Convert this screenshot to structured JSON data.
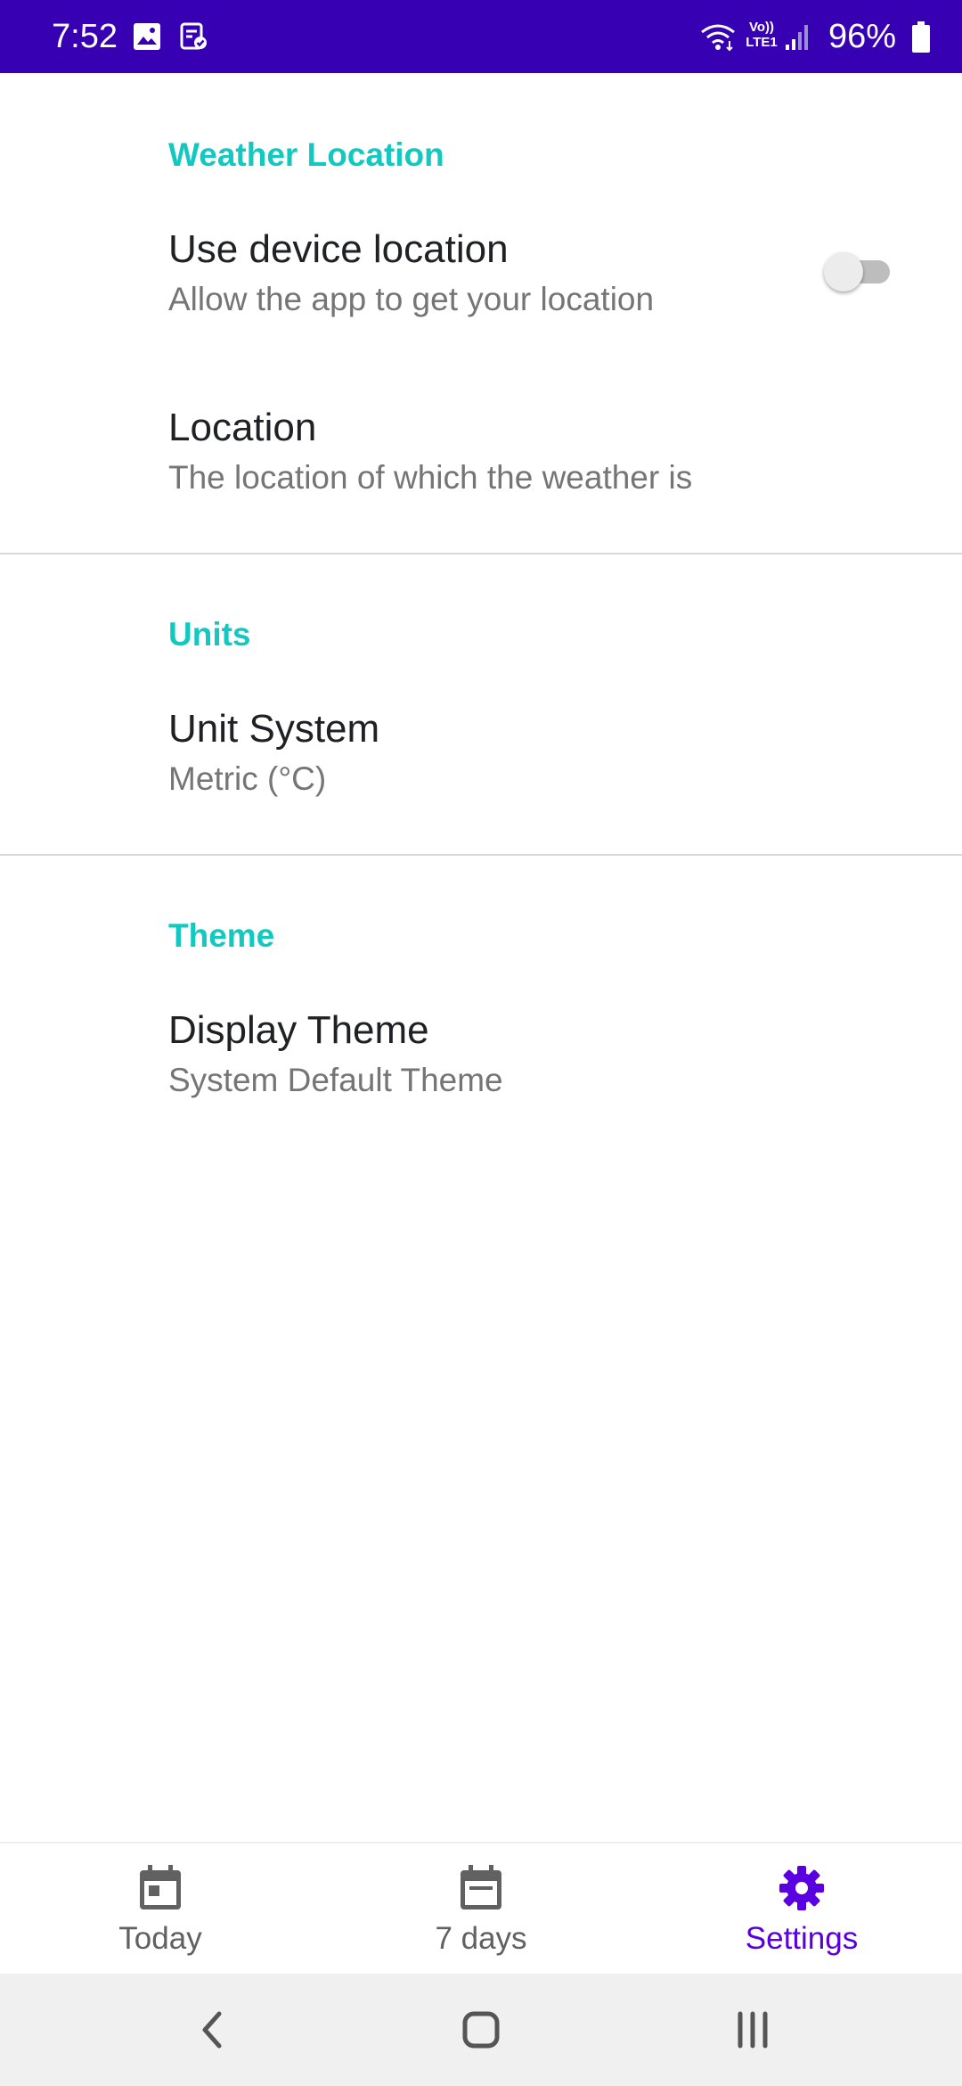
{
  "status_bar": {
    "time": "7:52",
    "battery": "96%",
    "background": "#3700b3",
    "left_icons": [
      "gallery-icon",
      "task-done-icon"
    ],
    "right_icons": [
      "wifi-icon",
      "volte-lte-icon",
      "signal-icon",
      "battery-icon"
    ],
    "volte_top": "Vo))",
    "volte_bottom": "LTE1"
  },
  "settings": {
    "accent_color": "#12c9c2",
    "sections": [
      {
        "header": "Weather Location",
        "items": [
          {
            "title": "Use device location",
            "summary": "Allow the app to get your location",
            "toggle": false
          },
          {
            "title": "Location",
            "summary": "The location of which the weather is"
          }
        ]
      },
      {
        "header": "Units",
        "items": [
          {
            "title": "Unit System",
            "summary": "Metric (°C)"
          }
        ]
      },
      {
        "header": "Theme",
        "items": [
          {
            "title": "Display Theme",
            "summary": "System Default Theme"
          }
        ]
      }
    ]
  },
  "bottom_nav": {
    "active_color": "#5a00e0",
    "items": [
      {
        "label": "Today",
        "icon": "calendar-today-icon",
        "active": false
      },
      {
        "label": "7 days",
        "icon": "calendar-week-icon",
        "active": false
      },
      {
        "label": "Settings",
        "icon": "gear-icon",
        "active": true
      }
    ]
  },
  "system_nav": {
    "buttons": [
      "back-icon",
      "home-icon",
      "recents-icon"
    ]
  }
}
